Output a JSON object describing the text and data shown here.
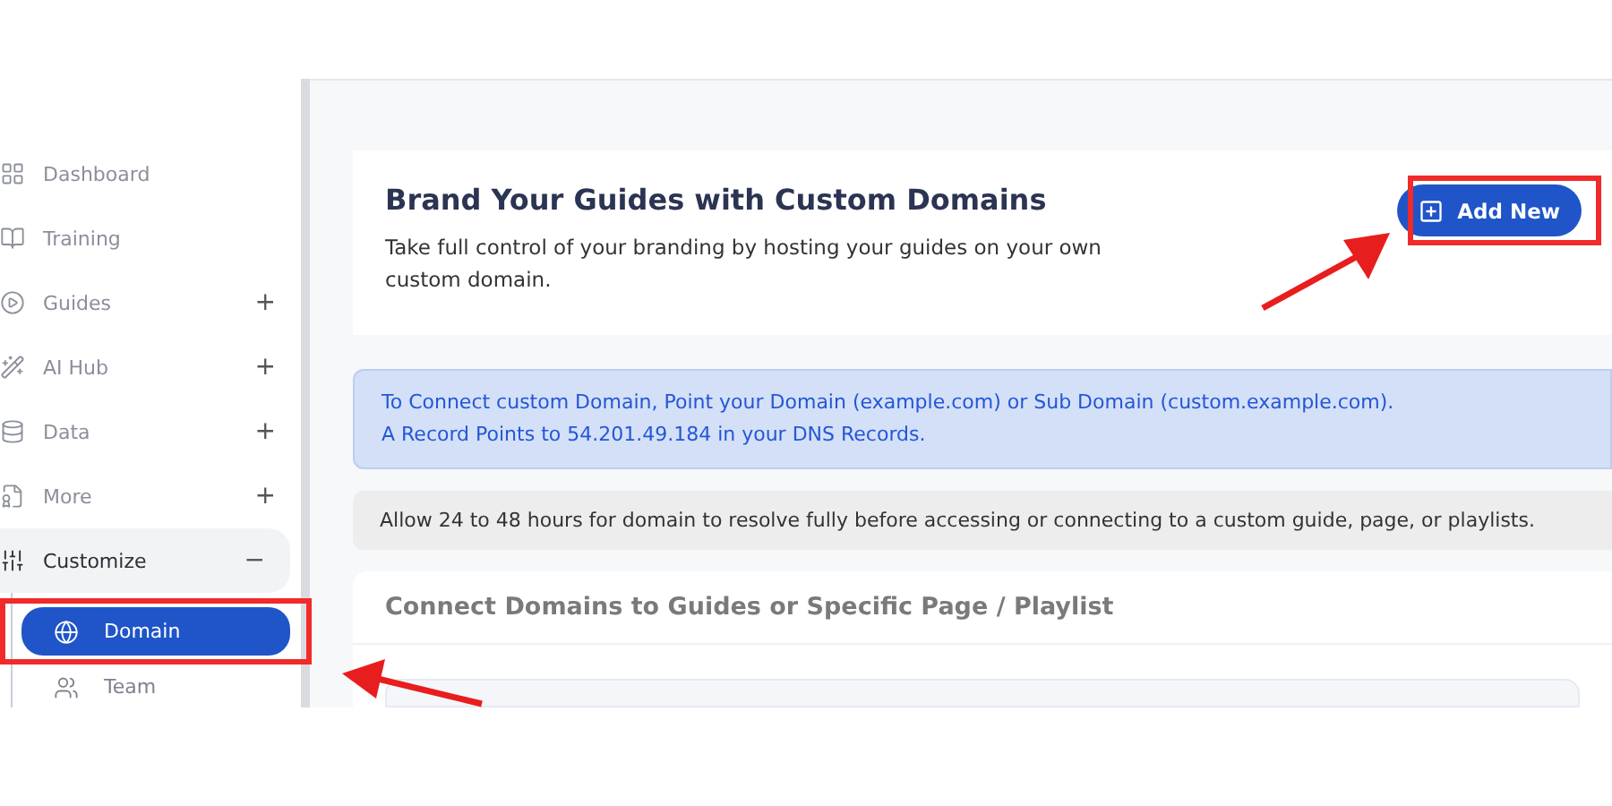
{
  "sidebar": {
    "items": [
      {
        "label": "Dashboard",
        "kind": "link"
      },
      {
        "label": "Training",
        "kind": "link"
      },
      {
        "label": "Guides",
        "kind": "group",
        "expanded": false,
        "toggle": "+"
      },
      {
        "label": "AI Hub",
        "kind": "group",
        "expanded": false,
        "toggle": "+"
      },
      {
        "label": "Data",
        "kind": "group",
        "expanded": false,
        "toggle": "+"
      },
      {
        "label": "More",
        "kind": "group",
        "expanded": false,
        "toggle": "+"
      },
      {
        "label": "Customize",
        "kind": "group",
        "expanded": true,
        "toggle": "−",
        "children": [
          {
            "label": "Domain",
            "selected": true
          },
          {
            "label": "Team",
            "selected": false
          }
        ]
      }
    ]
  },
  "header_card": {
    "title": "Brand Your Guides with Custom Domains",
    "description": "Take full control of your branding by hosting your guides on your own custom domain.",
    "button": "Add New"
  },
  "info_notice": {
    "lines": [
      "To Connect custom Domain, Point your Domain (example.com) or Sub Domain (custom.example.com).",
      "A Record Points to 54.201.49.184 in your DNS Records."
    ]
  },
  "note": "Allow 24 to 48 hours for domain to resolve fully before accessing or connecting to a custom guide, page, or playlists.",
  "connect_card": {
    "title": "Connect Domains to Guides or Specific Page / Playlist"
  }
}
